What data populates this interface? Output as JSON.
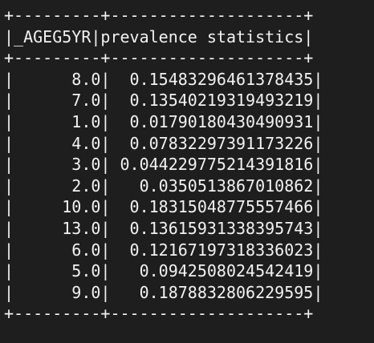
{
  "table": {
    "border_top": "+---------+--------------------+",
    "header_line": "|_AGEG5YR|prevalence statistics|",
    "border_mid": "+---------+--------------------+",
    "rows": [
      "|      8.0|  0.15483296461378435|",
      "|      7.0|  0.13540219319493219|",
      "|      1.0|  0.01790180430490931|",
      "|      4.0|  0.07832297391173226|",
      "|      3.0| 0.044229775214391816|",
      "|      2.0|   0.0350513867010862|",
      "|     10.0|  0.18315048775557466|",
      "|     13.0|  0.13615931338395743|",
      "|      6.0|  0.12167197318336023|",
      "|      5.0|   0.0942508024542419|",
      "|      9.0|   0.1878832806229595|"
    ],
    "border_bottom": "+---------+--------------------+"
  }
}
